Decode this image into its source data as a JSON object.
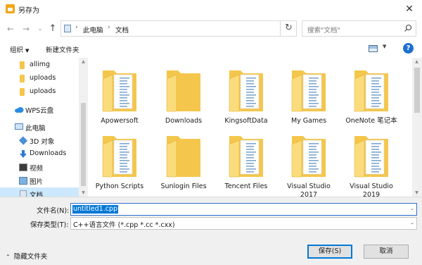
{
  "window": {
    "title": "另存为",
    "close_glyph": "✕"
  },
  "nav": {
    "back_glyph": "←",
    "forward_glyph": "→",
    "recent_glyph": "⌄",
    "up_glyph": "↑",
    "path": [
      "此电脑",
      "文档"
    ],
    "path_sep": "›",
    "dropdown_glyph": "⌄",
    "refresh_glyph": "↻",
    "search_placeholder": "搜索\"文档\""
  },
  "toolbar": {
    "organize_label": "组织",
    "organize_arrow": "▼",
    "new_folder_label": "新建文件夹",
    "view_arrow": "▼",
    "help_label": "?"
  },
  "sidebar": {
    "items": [
      {
        "label": "allimg",
        "icon": "folder-icon"
      },
      {
        "label": "uploads",
        "icon": "folder-icon"
      },
      {
        "label": "uploads",
        "icon": "folder-icon"
      },
      {
        "label": "WPS云盘",
        "icon": "cloud-icon"
      },
      {
        "label": "此电脑",
        "icon": "computer-icon"
      },
      {
        "label": "3D 对象",
        "icon": "3d-objects-icon"
      },
      {
        "label": "Downloads",
        "icon": "download-icon"
      },
      {
        "label": "视频",
        "icon": "video-icon"
      },
      {
        "label": "图片",
        "icon": "picture-icon"
      },
      {
        "label": "文档",
        "icon": "document-icon"
      }
    ],
    "selected": "文档"
  },
  "files": [
    {
      "name": "Apowersoft",
      "type": "doc-folder"
    },
    {
      "name": "Downloads",
      "type": "plain-folder"
    },
    {
      "name": "KingsoftData",
      "type": "doc-folder"
    },
    {
      "name": "My Games",
      "type": "doc-folder"
    },
    {
      "name": "OneNote 笔记本",
      "type": "doc-folder"
    },
    {
      "name": "Python Scripts",
      "type": "doc-folder"
    },
    {
      "name": "Sunlogin Files",
      "type": "plain-folder"
    },
    {
      "name": "Tencent Files",
      "type": "doc-folder"
    },
    {
      "name": "Visual Studio\n2017",
      "type": "doc-folder"
    },
    {
      "name": "Visual Studio\n2019",
      "type": "doc-folder"
    }
  ],
  "form": {
    "filename_label": "文件名(N):",
    "filename_value": "untitled1.cpp",
    "filetype_label": "保存类型(T):",
    "filetype_value": "C++语言文件 (*.cpp *.cc *.cxx)",
    "dropdown_glyph": "⌄",
    "hide_folders_chevron": "⌃",
    "hide_folders_label": "隐藏文件夹",
    "save_label": "保存(S)",
    "cancel_label": "取消"
  },
  "colors": {
    "folder": "#f4c64b",
    "folder_light": "#fbdc7c",
    "selection": "#cce8ff",
    "accent": "#0078d7"
  }
}
